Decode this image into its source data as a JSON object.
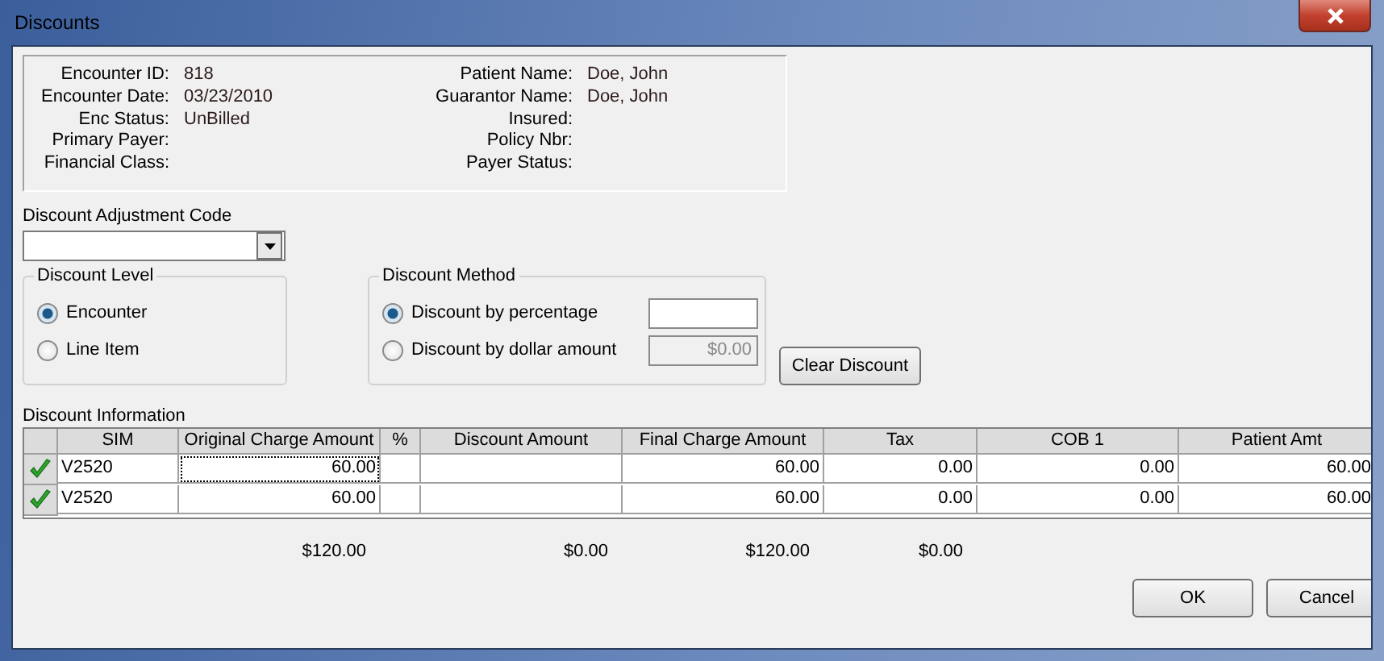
{
  "window": {
    "title": "Discounts"
  },
  "info": {
    "left": [
      {
        "label": "Encounter ID:",
        "value": "818"
      },
      {
        "label": "Encounter Date:",
        "value": "03/23/2010"
      },
      {
        "label": "Enc Status:",
        "value": "UnBilled"
      },
      {
        "label": "Primary Payer:"
      },
      {
        "label": "Financial Class:"
      }
    ],
    "right": [
      {
        "label": "Patient Name:",
        "value": "Doe, John"
      },
      {
        "label": "Guarantor Name:",
        "value": "Doe, John"
      },
      {
        "label": "Insured:"
      },
      {
        "label": "Policy Nbr:"
      },
      {
        "label": "Payer Status:"
      }
    ]
  },
  "adjustment_code": {
    "label": "Discount Adjustment Code"
  },
  "discount_level": {
    "title": "Discount Level",
    "options": [
      {
        "label": "Encounter",
        "selected": true
      },
      {
        "label": "Line Item",
        "selected": false
      }
    ]
  },
  "discount_method": {
    "title": "Discount Method",
    "options": [
      {
        "label": "Discount by percentage",
        "selected": true,
        "disabled": false
      },
      {
        "label": "Discount by dollar amount",
        "selected": false,
        "disabled": true,
        "value": "$0.00"
      }
    ]
  },
  "clear_button": "Clear Discount",
  "grid": {
    "title": "Discount Information",
    "columns": [
      "SIM",
      "Original Charge Amount",
      "%",
      "Discount Amount",
      "Final Charge Amount",
      "Tax",
      "COB 1",
      "Patient Amt"
    ],
    "rows": [
      {
        "checked": true,
        "focused": true,
        "sim": "V2520",
        "original": "60.00",
        "final": "60.00",
        "tax": "0.00",
        "cob1": "0.00",
        "patient": "60.00"
      },
      {
        "checked": true,
        "focused": false,
        "sim": "V2520",
        "original": "60.00",
        "final": "60.00",
        "tax": "0.00",
        "cob1": "0.00",
        "patient": "60.00"
      }
    ]
  },
  "totals": [
    "$120.00",
    "$0.00",
    "$120.00",
    "$0.00"
  ],
  "buttons": [
    "OK",
    "Cancel"
  ]
}
